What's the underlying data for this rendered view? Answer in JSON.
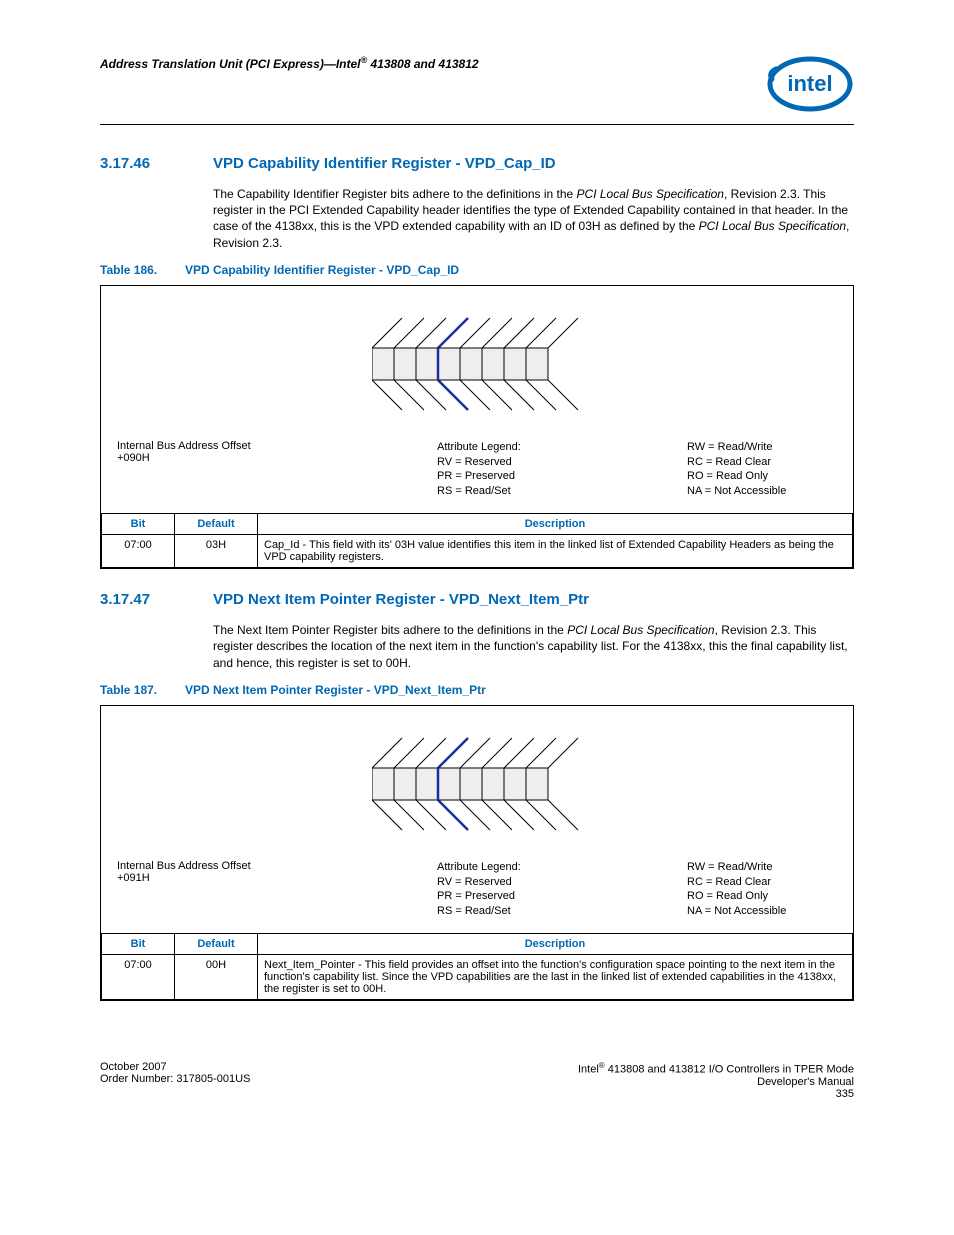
{
  "header": {
    "running": "Address Translation Unit (PCI Express)—Intel",
    "running_suffix": " 413808 and 413812",
    "reg_mark": "®"
  },
  "section1": {
    "num": "3.17.46",
    "title": "VPD Capability Identifier Register - VPD_Cap_ID",
    "para_a": "The Capability Identifier Register bits adhere to the definitions in the ",
    "para_em1": "PCI Local Bus Specification",
    "para_b": ", Revision 2.3. This register in the PCI Extended Capability header identifies the type of Extended Capability contained in that header. In the case of the 4138xx, this is the VPD extended capability with an ID of 03H as defined by the ",
    "para_em2": "PCI Local Bus Specification",
    "para_c": ", Revision 2.3.",
    "table_cap_num": "Table 186.",
    "table_cap_title": "VPD Capability Identifier Register - VPD_Cap_ID",
    "offset_label": "Internal Bus Address Offset",
    "offset_value": "+090H",
    "legend_title": "Attribute Legend:",
    "legend": {
      "rv": "RV = Reserved",
      "pr": "PR = Preserved",
      "rs": "RS = Read/Set",
      "rw": "RW = Read/Write",
      "rc": "RC = Read Clear",
      "ro": "RO = Read Only",
      "na": "NA = Not Accessible"
    },
    "cols": {
      "bit": "Bit",
      "def": "Default",
      "desc": "Description"
    },
    "row": {
      "bit": "07:00",
      "def": "03H",
      "desc": "Cap_Id - This field with its' 03H value identifies this item in the linked list of Extended Capability Headers as being the VPD capability registers."
    }
  },
  "section2": {
    "num": "3.17.47",
    "title": "VPD Next Item Pointer Register - VPD_Next_Item_Ptr",
    "para_a": "The Next Item Pointer Register bits adhere to the definitions in the ",
    "para_em1": "PCI Local Bus Specification",
    "para_b": ", Revision 2.3. This register describes the location of the next item in the function's capability list. For the 4138xx, this the final capability list, and hence, this register is set to 00H.",
    "table_cap_num": "Table 187.",
    "table_cap_title": "VPD Next Item Pointer Register - VPD_Next_Item_Ptr",
    "offset_label": "Internal Bus Address Offset",
    "offset_value": "+091H",
    "cols": {
      "bit": "Bit",
      "def": "Default",
      "desc": "Description"
    },
    "row": {
      "bit": "07:00",
      "def": "00H",
      "desc": "Next_Item_Pointer - This field provides an offset into the function's configuration space pointing to the next item in the function's capability list. Since the VPD capabilities are the last in the linked list of extended capabilities in the 4138xx, the register is set to 00H."
    }
  },
  "footer": {
    "left1": "October 2007",
    "left2": "Order Number: 317805-001US",
    "right1a": "Intel",
    "right1b": " 413808 and 413812 I/O Controllers in TPER Mode",
    "right2": "Developer's Manual",
    "right3": "335"
  }
}
